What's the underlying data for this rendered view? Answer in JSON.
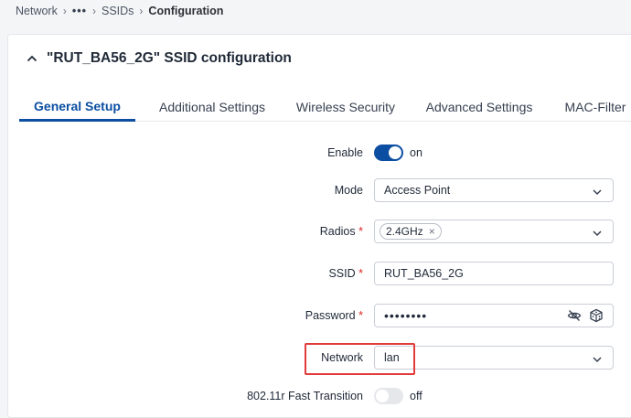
{
  "breadcrumb": {
    "items": [
      "Network",
      "•••",
      "SSIDs",
      "Configuration"
    ]
  },
  "card": {
    "title": "\"RUT_BA56_2G\" SSID configuration"
  },
  "tabs": [
    {
      "label": "General Setup",
      "active": true
    },
    {
      "label": "Additional Settings",
      "active": false
    },
    {
      "label": "Wireless Security",
      "active": false
    },
    {
      "label": "Advanced Settings",
      "active": false
    },
    {
      "label": "MAC-Filter",
      "active": false
    }
  ],
  "form": {
    "enable": {
      "label": "Enable",
      "state": "on"
    },
    "mode": {
      "label": "Mode",
      "value": "Access Point"
    },
    "radios": {
      "label": "Radios",
      "required": "*",
      "chip": "2.4GHz",
      "chip_remove": "×"
    },
    "ssid": {
      "label": "SSID",
      "required": "*",
      "value": "RUT_BA56_2G"
    },
    "password": {
      "label": "Password",
      "required": "*",
      "value": "••••••••"
    },
    "network": {
      "label": "Network",
      "value": "lan"
    },
    "fast_transition": {
      "label": "802.11r Fast Transition",
      "state": "off"
    }
  },
  "colors": {
    "accent": "#0b4ea2",
    "highlight": "#e23b3b",
    "required": "#dc2626"
  }
}
